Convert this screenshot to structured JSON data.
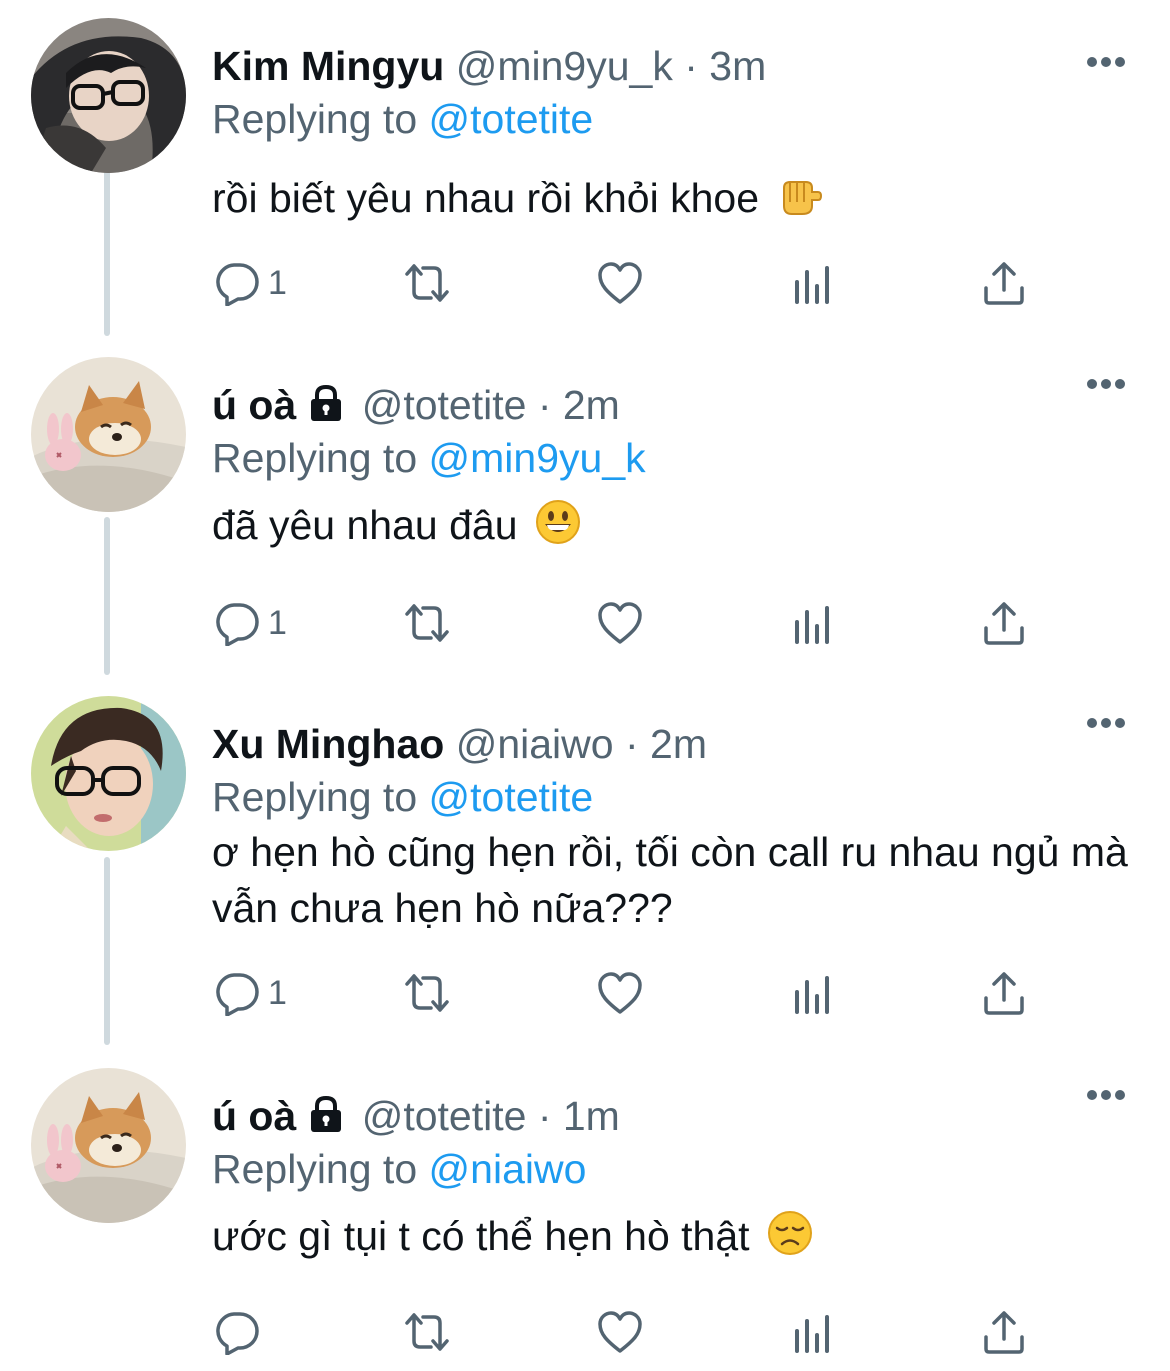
{
  "tweets": [
    {
      "name": "Kim Mingyu",
      "handle": "@min9yu_k",
      "separator": "·",
      "time": "3m",
      "replying_prefix": "Replying to",
      "replying_to": "@totetite",
      "text": "rồi biết yêu nhau rồi khỏi khoe",
      "emoji": "backhand-pointing-fist-emoji",
      "reply_count": "1",
      "locked": false
    },
    {
      "name": "ú oà",
      "handle": "@totetite",
      "separator": "·",
      "time": "2m",
      "replying_prefix": "Replying to",
      "replying_to": "@min9yu_k",
      "text": "đã yêu nhau đâu",
      "emoji": "grinning-face-emoji",
      "reply_count": "1",
      "locked": true
    },
    {
      "name": "Xu Minghao",
      "handle": "@niaiwo",
      "separator": "·",
      "time": "2m",
      "replying_prefix": "Replying to",
      "replying_to": "@totetite",
      "text": "ơ hẹn hò cũng hẹn rồi, tối còn call ru nhau ngủ mà vẫn chưa hẹn hò nữa???",
      "emoji": "",
      "reply_count": "1",
      "locked": false
    },
    {
      "name": "ú oà",
      "handle": "@totetite",
      "separator": "·",
      "time": "1m",
      "replying_prefix": "Replying to",
      "replying_to": "@niaiwo",
      "text": "ước gì tụi t có thể hẹn hò thật",
      "emoji": "disappointed-face-emoji",
      "reply_count": "",
      "locked": true
    }
  ],
  "colors": {
    "text": "#0f1419",
    "secondary": "#536471",
    "link": "#1d9bf0",
    "thread_line": "#cfd9de",
    "background": "#ffffff"
  }
}
